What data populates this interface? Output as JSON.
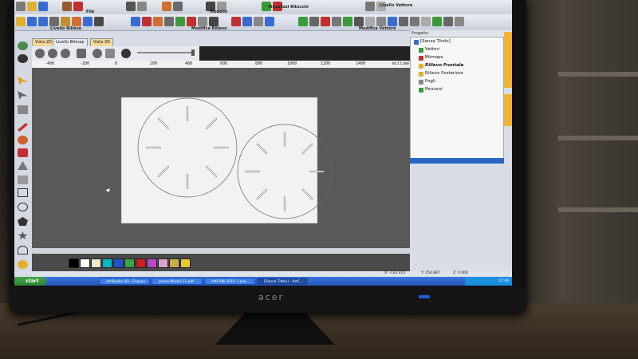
{
  "monitor": {
    "brand": "acer"
  },
  "toolbars": {
    "top_labels": [
      "File",
      "Modello",
      "Visualizzi Ritocchi",
      "Livello Vettore"
    ],
    "second_labels": [
      "Livello Rilievo",
      "Modifica Rilievo",
      "Modifica Vettore"
    ]
  },
  "tabs": [
    {
      "label": "Vista 2D"
    },
    {
      "label": "Livello Bitmap"
    },
    {
      "label": "Vista 3D"
    }
  ],
  "ruler": {
    "ticks": [
      "-400",
      "-200",
      "0",
      "200",
      "400",
      "600",
      "800",
      "1000",
      "1200",
      "1400"
    ],
    "unit_label": "millimetri"
  },
  "project_panel": {
    "title": "Progetto",
    "items": [
      {
        "label": "[Senza Titolo]"
      },
      {
        "label": "Vettori"
      },
      {
        "label": "Bitmaps"
      },
      {
        "label": "Rilievo Frontale"
      },
      {
        "label": "Rilievo Posteriore"
      },
      {
        "label": "Fogli"
      },
      {
        "label": "Percorsi"
      }
    ]
  },
  "side_tabs": [
    "Livelli Rilievo Originali",
    "Tutorial"
  ],
  "palette": {
    "colors": [
      "#000000",
      "#ffffff",
      "#f2e6c8",
      "#00b8c8",
      "#2255cc",
      "#3aa648",
      "#cc2222",
      "#b24cc8",
      "#e0a0c8",
      "#c8b048",
      "#e8c830"
    ]
  },
  "status": {
    "x": "X: -133.315",
    "y": "Y: 254.887",
    "z": "Z: 0.000"
  },
  "taskbar": {
    "start_label": "start",
    "tasks": [
      "ArtStudio 4D - Engrav...",
      "prova-Model.11.pdf -...",
      "ArtCAM 2015 - [pro...",
      "[Senza Titolo] - ArtC..."
    ],
    "clock": "17:49"
  },
  "colors": {
    "accent": "#f0b432",
    "taskbar": "#2453b8",
    "canvas_bg": "#595959",
    "sheet": "#f2f2f2"
  }
}
